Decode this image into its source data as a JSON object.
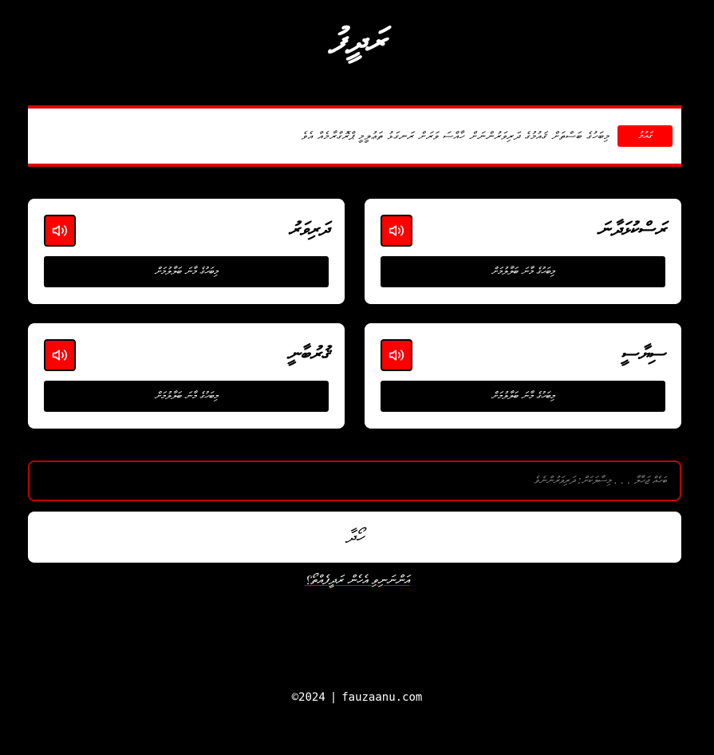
{
  "header": {
    "title": "ރަދީފު"
  },
  "banner": {
    "badge_label": "ގައުމު",
    "text": "މިބަހުގެ ބަސްތަށް ޤައުމުގެ ދަރިވަރުންނަށް ހާއްސަ ވަރަށް ރަނގަޅު ތަޢުލީމީ ޕްރޮގްރާމެއް އެވެ",
    "accent_color": "#e00000"
  },
  "cards": [
    {
      "name": "ރަސްކުޅަދާނަ",
      "speaker_icon": "speaker-icon",
      "detail_label": "މިބަހުގެ މާނަ ބަލާލުމަށް"
    },
    {
      "name": "ދަރިވަރު",
      "speaker_icon": "speaker-icon",
      "detail_label": "މިބަހުގެ މާނަ ބަލާލުމަށް"
    },
    {
      "name": "ސިޔާސީ",
      "speaker_icon": "speaker-icon",
      "detail_label": "މިބަހުގެ މާނަ ބަލާލުމަށް"
    },
    {
      "name": "ޤުރުބާނީ",
      "speaker_icon": "speaker-icon",
      "detail_label": "މިބަހުގެ މާނަ ބަލާލުމަށް"
    }
  ],
  "search": {
    "placeholder": "ބަހެއް ޖަހާލާ . . . މިސާލަކަށް: ދަރިވަރުންނެވެ",
    "value": ""
  },
  "submit": {
    "label": "ހޯދާ"
  },
  "help": {
    "link_text": "އަންނަނިވި އެހެން ރަދީފެއްތޯ؟"
  },
  "footer": {
    "copyright": "©2024",
    "separator": "|",
    "site": "fauzaanu.com"
  },
  "colors": {
    "background": "#000000",
    "accent": "#ff0000",
    "card": "#ffffff"
  }
}
